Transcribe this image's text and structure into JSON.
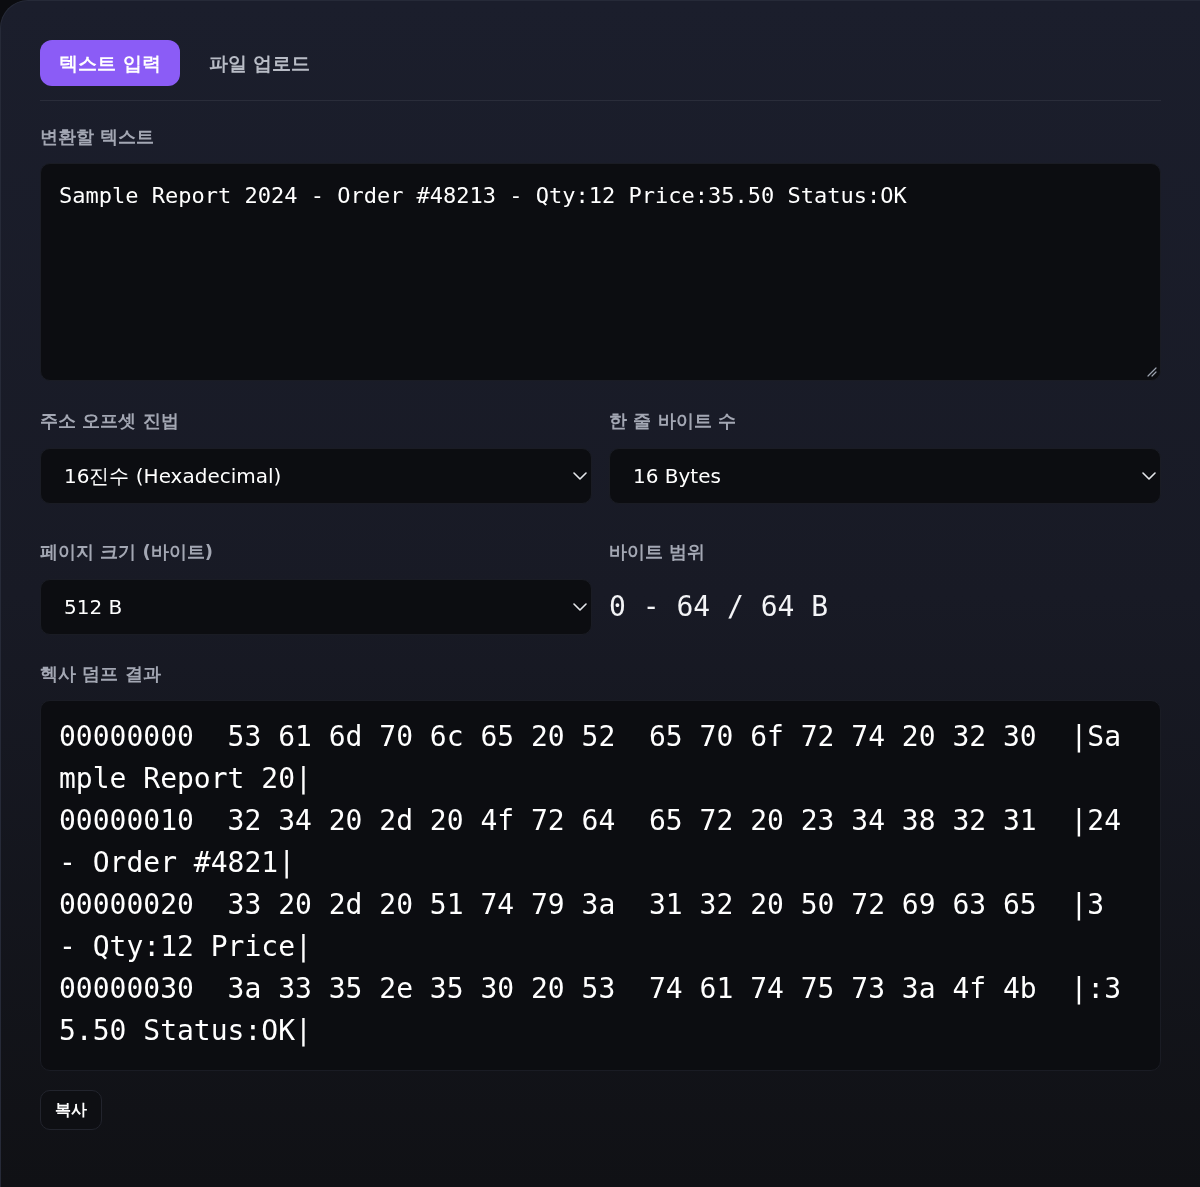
{
  "tabs": [
    {
      "label": "텍스트 입력",
      "selected": true
    },
    {
      "label": "파일 업로드",
      "selected": false
    }
  ],
  "text_input": {
    "label": "변환할 텍스트",
    "value": "Sample Report 2024 - Order #48213 - Qty:12 Price:35.50 Status:OK"
  },
  "settings": [
    {
      "kind": "select",
      "label": "주소 오프셋 진법",
      "value": "16진수 (Hexadecimal)"
    },
    {
      "kind": "select",
      "label": "한 줄 바이트 수",
      "value": "16 Bytes"
    },
    {
      "kind": "select",
      "label": "페이지 크기 (바이트)",
      "value": "512 B"
    },
    {
      "kind": "readout",
      "label": "바이트 범위",
      "value": "0 - 64 / 64 B"
    }
  ],
  "hex_dump": {
    "label": "헥사 덤프 결과",
    "lines": [
      "00000000  53 61 6d 70 6c 65 20 52  65 70 6f 72 74 20 32 30  |Sample Report 20|",
      "00000010  32 34 20 2d 20 4f 72 64  65 72 20 23 34 38 32 31  |24 - Order #4821|",
      "00000020  33 20 2d 20 51 74 79 3a  31 32 20 50 72 69 63 65  |3 - Qty:12 Price|",
      "00000030  3a 33 35 2e 35 30 20 53  74 61 74 75 73 3a 4f 4b  |:35.50 Status:OK|"
    ]
  },
  "copy_button": {
    "label": "복사"
  }
}
